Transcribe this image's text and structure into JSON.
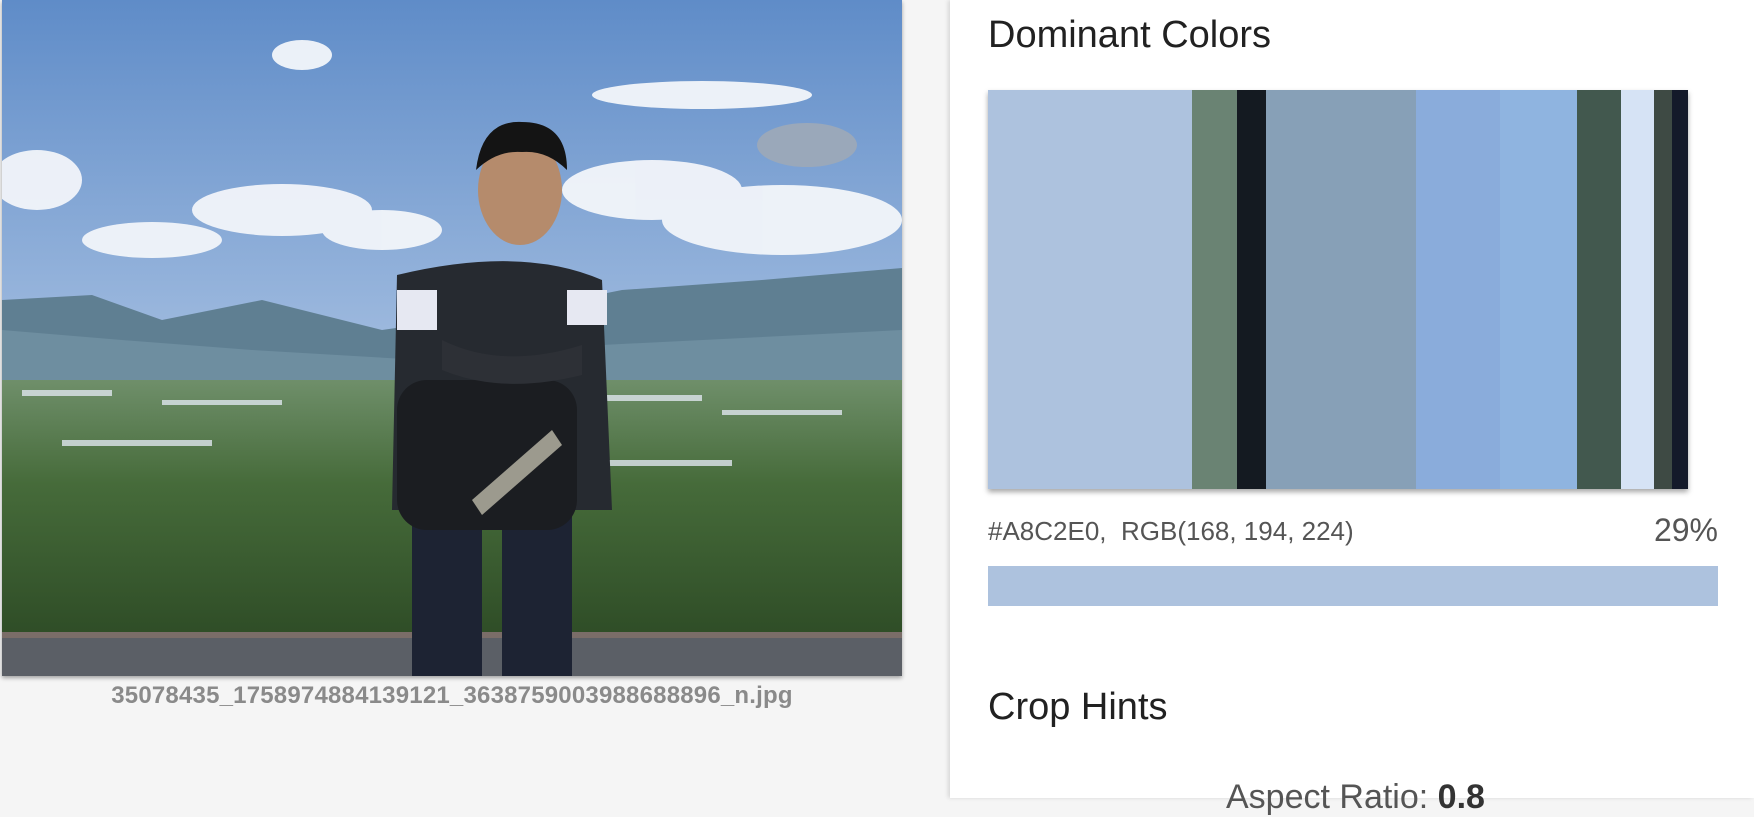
{
  "photo": {
    "filename": "35078435_1758974884139121_3638759003988688896_n.jpg"
  },
  "dominant_colors": {
    "title": "Dominant Colors",
    "swatches": [
      {
        "color": "#adc2de",
        "fraction": 0.29
      },
      {
        "color": "#6a8373",
        "fraction": 0.065
      },
      {
        "color": "#141a21",
        "fraction": 0.04
      },
      {
        "color": "#87a0b7",
        "fraction": 0.214
      },
      {
        "color": "#8aacdb",
        "fraction": 0.12
      },
      {
        "color": "#8fb4e0",
        "fraction": 0.109
      },
      {
        "color": "#42584e",
        "fraction": 0.063
      },
      {
        "color": "#d6e3f5",
        "fraction": 0.046
      },
      {
        "color": "#3e4a44",
        "fraction": 0.026
      },
      {
        "color": "#141a2a",
        "fraction": 0.023
      }
    ],
    "selected": {
      "hex": "#A8C2E0,",
      "rgb": "RGB(168, 194, 224)",
      "percent": "29%",
      "color": "#adc2de"
    }
  },
  "crop_hints": {
    "title": "Crop Hints",
    "aspect_label": "Aspect Ratio:",
    "aspect_value": "0.8"
  }
}
